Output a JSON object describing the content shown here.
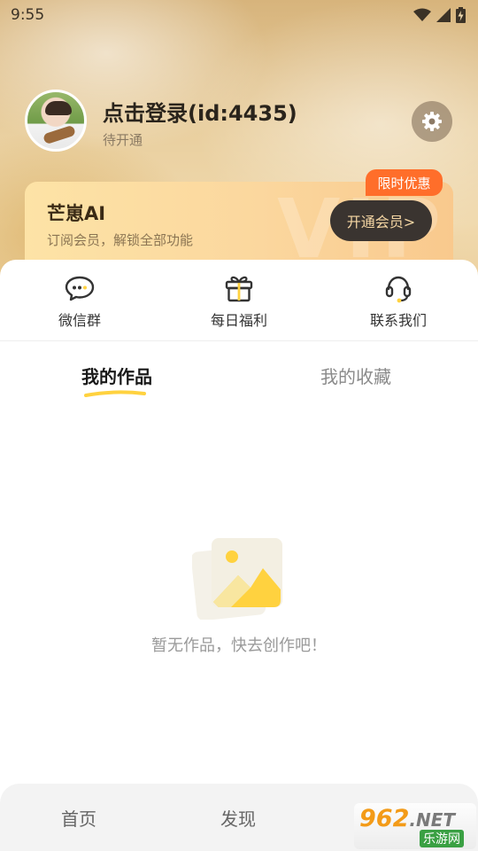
{
  "status_bar": {
    "time": "9:55",
    "icons": [
      "wifi-icon",
      "signal-icon",
      "battery-charging-icon"
    ]
  },
  "profile": {
    "title": "点击登录(id:4435)",
    "subtitle": "待开通",
    "settings_icon": "gear-icon"
  },
  "vip_card": {
    "name": "芒崽AI",
    "description": "订阅会员，解锁全部功能",
    "button_label": "开通会员>",
    "promo_badge": "限时优惠",
    "watermark_text": "VIP"
  },
  "quick_actions": [
    {
      "label": "微信群",
      "icon": "chat-bubble-icon"
    },
    {
      "label": "每日福利",
      "icon": "gift-icon"
    },
    {
      "label": "联系我们",
      "icon": "headset-icon"
    }
  ],
  "tabs": {
    "active": "我的作品",
    "inactive": "我的收藏"
  },
  "empty_state": {
    "text": "暂无作品，快去创作吧！",
    "icon": "image-placeholder-icon"
  },
  "bottom_nav": {
    "home": "首页",
    "discover": "发现"
  },
  "site_watermark": {
    "logo": "962",
    "logo_suffix": ".NET",
    "sub": "乐游网"
  },
  "colors": {
    "accent_yellow": "#FFD23F",
    "promo_orange": "#FF6E2A",
    "vip_button_bg": "#3A3430"
  }
}
